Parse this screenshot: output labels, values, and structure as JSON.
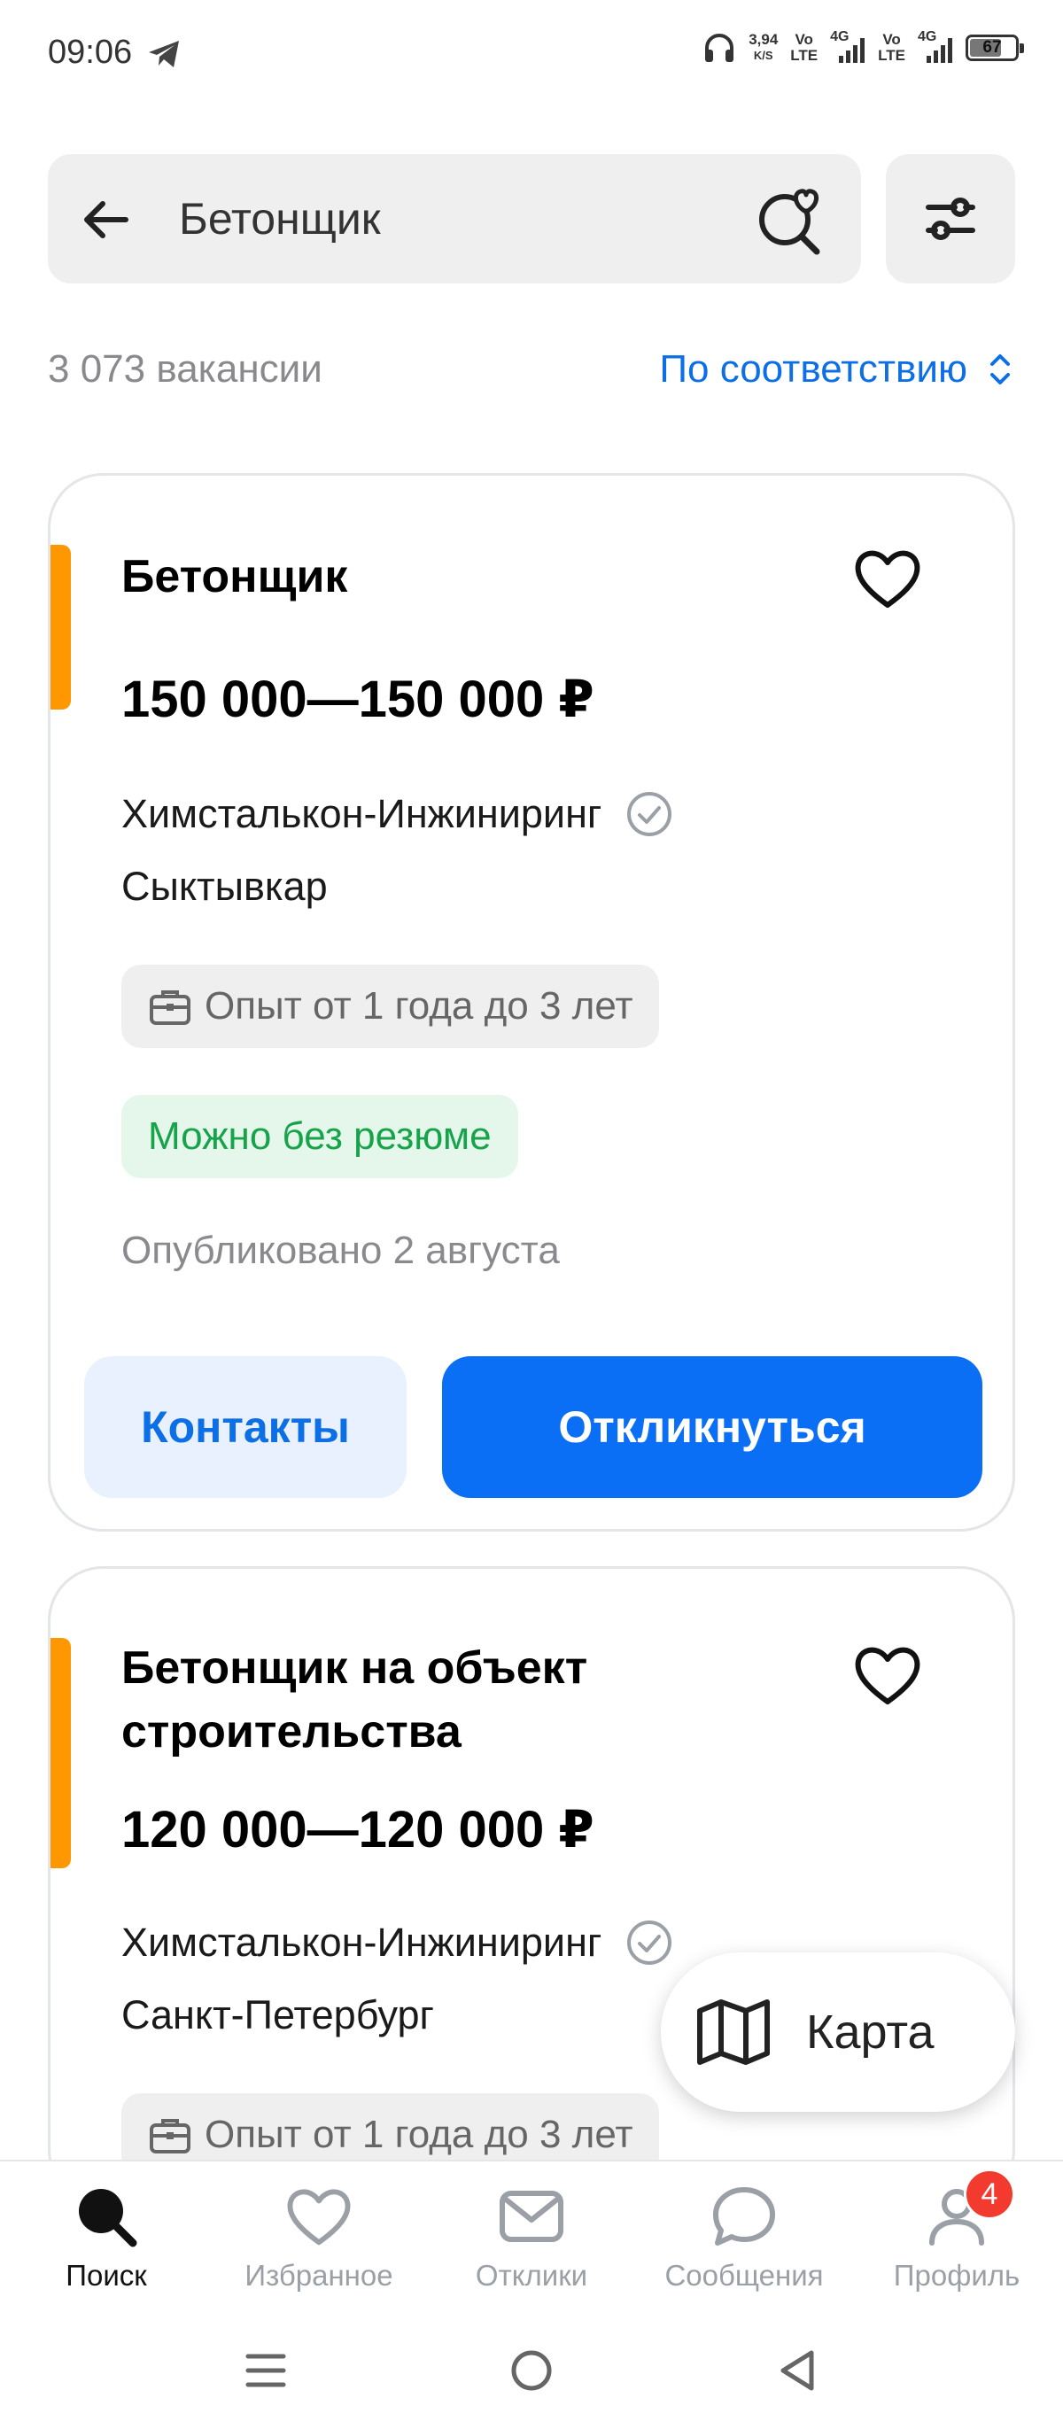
{
  "status_bar": {
    "time": "09:06",
    "net_speed_value": "3,94",
    "net_speed_unit": "K/S",
    "volte1_top": "Vo",
    "volte1_bottom": "LTE",
    "net1": "4G",
    "volte2_top": "Vo",
    "volte2_bottom": "LTE",
    "net2": "4G",
    "battery": "67"
  },
  "search": {
    "query": "Бетонщик"
  },
  "results": {
    "count": "3 073 вакансии",
    "sort_label": "По соответствию"
  },
  "vacancies": [
    {
      "title": "Бетонщик",
      "salary": "150 000—150 000 ₽",
      "company": "Химсталькон-Инжиниринг",
      "city": "Сыктывкар",
      "experience": "Опыт от 1 года до 3 лет",
      "no_resume": "Можно без резюме",
      "published": "Опубликовано 2 августа",
      "contacts_label": "Контакты",
      "apply_label": "Откликнуться"
    },
    {
      "title": "Бетонщик на объект строительства",
      "salary": "120 000—120 000 ₽",
      "company": "Химсталькон-Инжиниринг",
      "city": "Санкт-Петербург",
      "experience": "Опыт от 1 года до 3 лет"
    }
  ],
  "map_button": {
    "label": "Карта"
  },
  "bottom_nav": {
    "items": [
      {
        "label": "Поиск",
        "icon": "search-icon",
        "active": true
      },
      {
        "label": "Избранное",
        "icon": "heart-icon"
      },
      {
        "label": "Отклики",
        "icon": "envelope-icon"
      },
      {
        "label": "Сообщения",
        "icon": "chat-bubble-icon"
      },
      {
        "label": "Профиль",
        "icon": "person-icon",
        "badge": "4"
      }
    ]
  },
  "colors": {
    "accent_blue": "#0a6ff5",
    "accent_orange": "#ff9800",
    "success_green": "#16a34a",
    "badge_red": "#f23a2f"
  }
}
